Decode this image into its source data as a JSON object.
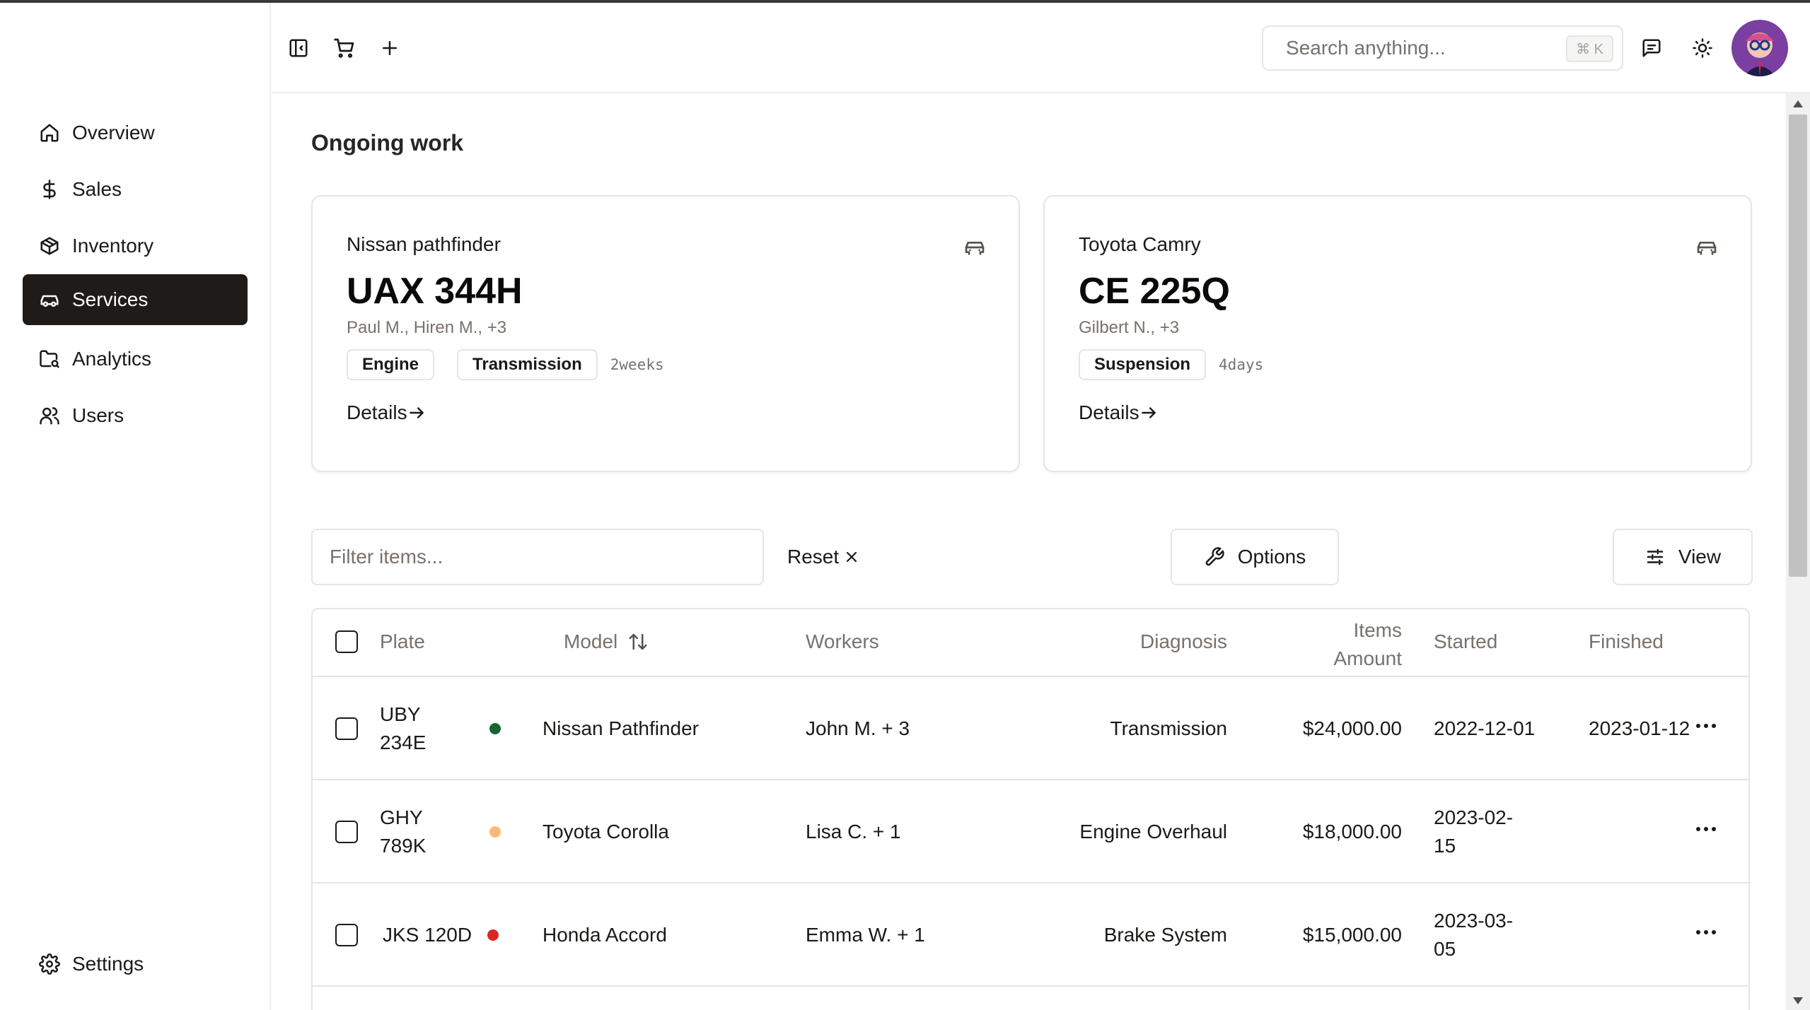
{
  "sidebar": {
    "items": [
      {
        "label": "Overview",
        "icon": "home-icon"
      },
      {
        "label": "Sales",
        "icon": "dollar-icon"
      },
      {
        "label": "Inventory",
        "icon": "package-icon"
      },
      {
        "label": "Services",
        "icon": "car-icon",
        "active": true
      },
      {
        "label": "Analytics",
        "icon": "folder-chart-icon"
      },
      {
        "label": "Users",
        "icon": "users-icon"
      }
    ],
    "settings_label": "Settings"
  },
  "header": {
    "search_placeholder": "Search anything...",
    "search_shortcut": "⌘ K"
  },
  "main": {
    "section_title": "Ongoing work",
    "cards": [
      {
        "model": "Nissan pathfinder",
        "plate": "UAX 344H",
        "workers": "Paul M., Hiren M., +3",
        "tags": [
          "Engine",
          "Transmission"
        ],
        "duration": "2weeks",
        "details_label": "Details"
      },
      {
        "model": "Toyota Camry",
        "plate": "CE 225Q",
        "workers": "Gilbert N., +3",
        "tags": [
          "Suspension"
        ],
        "duration": "4days",
        "details_label": "Details"
      }
    ],
    "toolbar": {
      "filter_placeholder": "Filter items...",
      "reset_label": "Reset",
      "options_label": "Options",
      "view_label": "View"
    },
    "table": {
      "columns": {
        "plate": "Plate",
        "model": "Model",
        "workers": "Workers",
        "diagnosis": "Diagnosis",
        "items_amount_1": "Items",
        "items_amount_2": "Amount",
        "started": "Started",
        "finished": "Finished"
      },
      "rows": [
        {
          "plate_1": "UBY",
          "plate_2": "234E",
          "status_color": "#166534",
          "model": "Nissan Pathfinder",
          "workers": "John M. + 3",
          "diagnosis": "Transmission",
          "amount": "$24,000.00",
          "started_1": "2022-12-01",
          "started_2": "",
          "finished": "2023-01-12"
        },
        {
          "plate_1": "GHY",
          "plate_2": "789K",
          "status_color": "#fdba74",
          "model": "Toyota Corolla",
          "workers": "Lisa C. + 1",
          "diagnosis": "Engine Overhaul",
          "amount": "$18,000.00",
          "started_1": "2023-02-",
          "started_2": "15",
          "finished": ""
        },
        {
          "plate_1": "JKS 120D",
          "plate_2": "",
          "status_color": "#dc2626",
          "model": "Honda Accord",
          "workers": "Emma W. + 1",
          "diagnosis": "Brake System",
          "amount": "$15,000.00",
          "started_1": "2023-03-",
          "started_2": "05",
          "finished": ""
        }
      ]
    }
  }
}
